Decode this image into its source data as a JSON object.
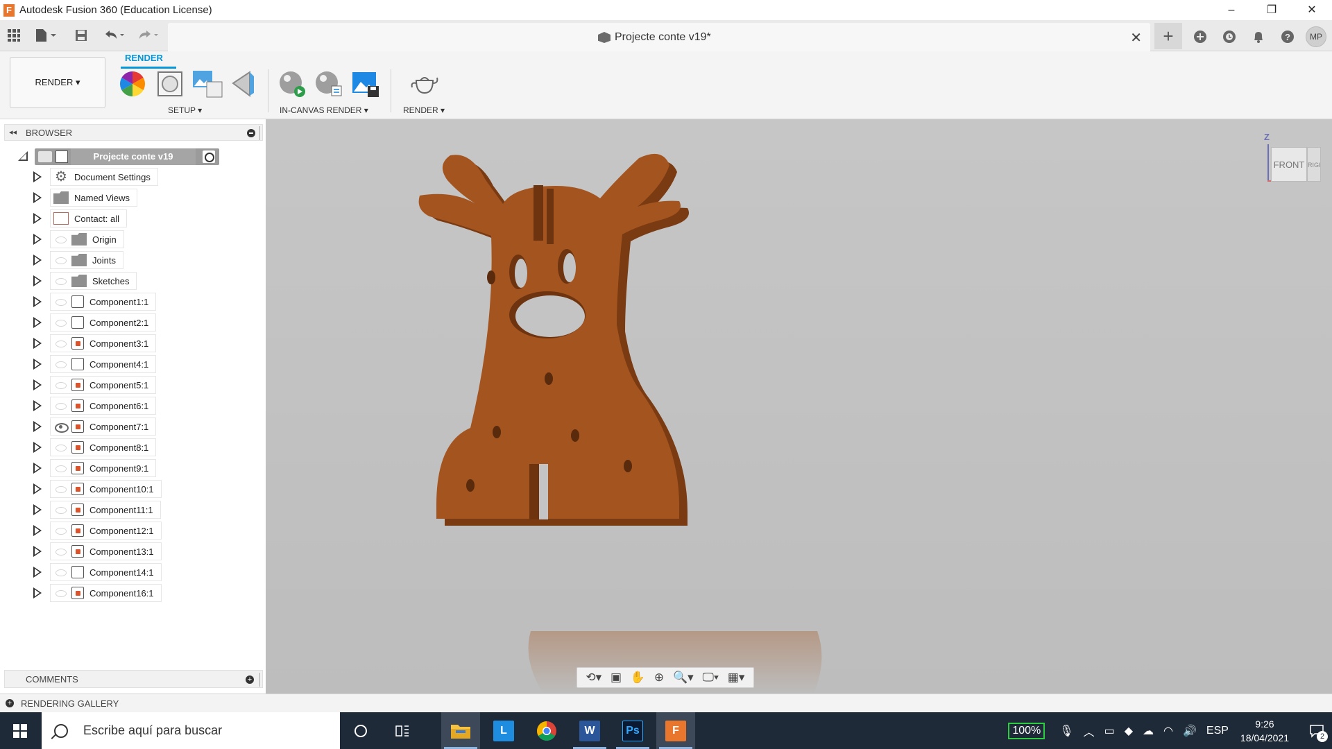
{
  "window": {
    "title": "Autodesk Fusion 360 (Education License)",
    "app_icon_letter": "F",
    "controls": [
      "–",
      "❐",
      "✕"
    ]
  },
  "appbar": {
    "document_title": "Projecte conte v19*",
    "close_glyph": "✕",
    "avatar_initials": "MP"
  },
  "toolbar": {
    "workspace_label": "RENDER ▾",
    "active_tab": "RENDER",
    "groups": {
      "setup": "SETUP ▾",
      "in_canvas": "IN-CANVAS RENDER ▾",
      "render": "RENDER ▾"
    }
  },
  "browser": {
    "header": "BROWSER",
    "root": "Projecte conte v19",
    "items": [
      {
        "label": "Document Settings",
        "icon": "gear",
        "vis": "none"
      },
      {
        "label": "Named Views",
        "icon": "folder",
        "vis": "none"
      },
      {
        "label": "Contact: all",
        "icon": "contact",
        "vis": "none"
      },
      {
        "label": "Origin",
        "icon": "folder",
        "vis": "hidden"
      },
      {
        "label": "Joints",
        "icon": "folder",
        "vis": "hidden"
      },
      {
        "label": "Sketches",
        "icon": "folder",
        "vis": "hidden"
      },
      {
        "label": "Component1:1",
        "icon": "comp",
        "vis": "hidden"
      },
      {
        "label": "Component2:1",
        "icon": "comp",
        "vis": "hidden"
      },
      {
        "label": "Component3:1",
        "icon": "compjoint",
        "vis": "hidden"
      },
      {
        "label": "Component4:1",
        "icon": "comp",
        "vis": "hidden"
      },
      {
        "label": "Component5:1",
        "icon": "compjoint",
        "vis": "hidden"
      },
      {
        "label": "Component6:1",
        "icon": "compjoint",
        "vis": "hidden"
      },
      {
        "label": "Component7:1",
        "icon": "compjoint",
        "vis": "shown"
      },
      {
        "label": "Component8:1",
        "icon": "compjoint",
        "vis": "hidden"
      },
      {
        "label": "Component9:1",
        "icon": "compjoint",
        "vis": "hidden"
      },
      {
        "label": "Component10:1",
        "icon": "compjoint",
        "vis": "hidden"
      },
      {
        "label": "Component11:1",
        "icon": "compjoint",
        "vis": "hidden"
      },
      {
        "label": "Component12:1",
        "icon": "compjoint",
        "vis": "hidden"
      },
      {
        "label": "Component13:1",
        "icon": "compjoint",
        "vis": "hidden"
      },
      {
        "label": "Component14:1",
        "icon": "comp",
        "vis": "hidden"
      },
      {
        "label": "Component16:1",
        "icon": "compjoint",
        "vis": "hidden"
      }
    ]
  },
  "viewcube": {
    "face": "FRONT",
    "side": "RIGHT",
    "axis_z": "Z"
  },
  "comments": {
    "header": "COMMENTS"
  },
  "gallery": {
    "header": "RENDERING GALLERY"
  },
  "taskbar": {
    "search_placeholder": "Escribe aquí para buscar",
    "battery": "100%",
    "language": "ESP",
    "time": "9:26",
    "date": "18/04/2021",
    "notification_count": "2"
  },
  "colors": {
    "accent": "#0696d7",
    "model": "#a4541f",
    "model_shadow": "#7a3a12"
  }
}
